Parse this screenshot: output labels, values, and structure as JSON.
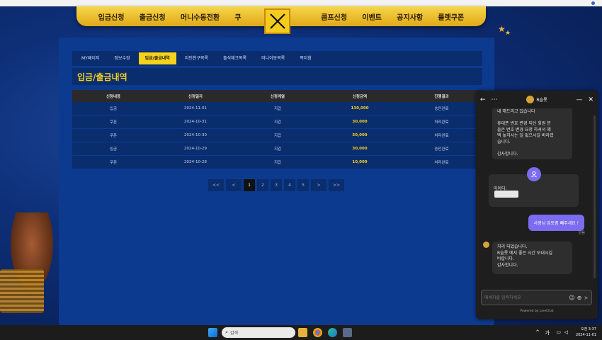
{
  "menu": {
    "items": [
      "입금신청",
      "출금신청",
      "머니수동전환",
      "쿠",
      "콤프신청",
      "이벤트",
      "공지사항",
      "룰렛쿠폰"
    ]
  },
  "tabs": [
    "MY페이지",
    "정보수정",
    "입금/출금내역",
    "지인친구목록",
    "출석체크목록",
    "머니이동목록",
    "쪽지함"
  ],
  "active_tab": 2,
  "page_title": "입금/출금내역",
  "table": {
    "headers": [
      "신청내용",
      "신청일자",
      "신청계열",
      "신청금액",
      "진행결과"
    ],
    "rows": [
      [
        "입금",
        "2024-11-01",
        "지갑",
        "130,000",
        "승인완료"
      ],
      [
        "쿠폰",
        "2024-10-31",
        "지갑",
        "30,000",
        "처리완료"
      ],
      [
        "쿠폰",
        "2024-10-30",
        "지갑",
        "50,000",
        "처리완료"
      ],
      [
        "입금",
        "2024-10-29",
        "지갑",
        "30,000",
        "승인완료"
      ],
      [
        "쿠폰",
        "2024-10-28",
        "지갑",
        "10,000",
        "처리완료"
      ]
    ]
  },
  "pager": {
    "first": "<<",
    "prev": "<",
    "pages": [
      "1",
      "2",
      "3",
      "4",
      "5"
    ],
    "current": "1",
    "next": ">",
    "last": ">>"
  },
  "chat": {
    "title": "R슬롯",
    "msg1_lines": [
      "내 해드리고 있습니다",
      "",
      "휴대폰 번호 변경 되신 회원 분",
      "들은 번호 변경 요청 하셔서 혜",
      "택 놓치시는 일 없으시길 바라겠",
      "습니다.",
      "",
      "감사합니다."
    ],
    "msg2_label": "아이디:",
    "my_msg": "사장님 업토좀 빼주세요 !",
    "read_label": "읽음",
    "msg3_lines": [
      "처리 되었습니다.",
      "R슬롯 에서 좋은 시간 보내시길",
      "바랍니다.",
      "감사합니다."
    ],
    "input_placeholder": "메세지를 입력하세요",
    "powered": "Powered by LiveChat"
  },
  "taskbar": {
    "search_label": "검색",
    "ime": "가",
    "time": "오전 3:37",
    "date": "2024-11-01"
  }
}
